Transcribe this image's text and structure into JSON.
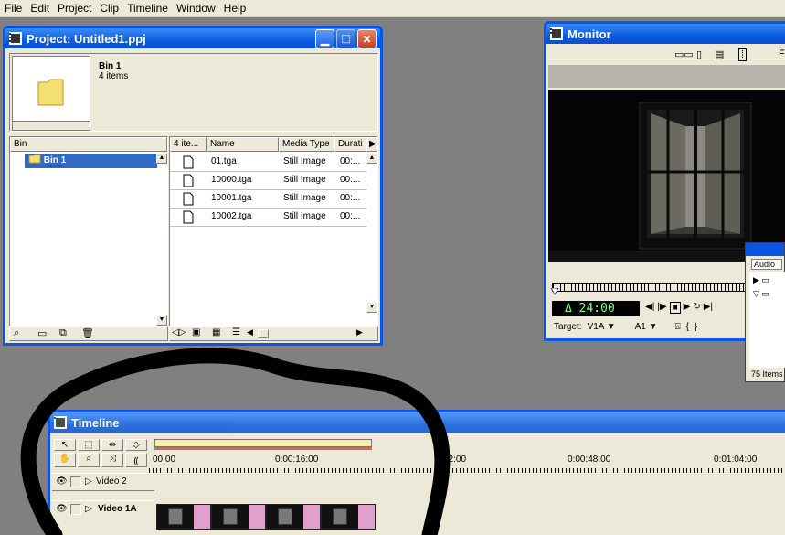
{
  "menubar": {
    "items": [
      "File",
      "Edit",
      "Project",
      "Clip",
      "Timeline",
      "Window",
      "Help"
    ]
  },
  "project": {
    "title": "Project: Untitled1.ppj",
    "bin_name": "Bin 1",
    "bin_count": "4 items",
    "bin_header": "Bin",
    "tree_item": "Bin 1",
    "columns": [
      "4 ite...",
      "Name",
      "Media Type",
      "Durati"
    ],
    "files": [
      {
        "name": "01.tga",
        "type": "Still Image",
        "duration": "00:..."
      },
      {
        "name": "10000.tga",
        "type": "Still Image",
        "duration": "00:..."
      },
      {
        "name": "10001.tga",
        "type": "Still Image",
        "duration": "00:..."
      },
      {
        "name": "10002.tga",
        "type": "Still Image",
        "duration": "00:..."
      }
    ]
  },
  "monitor": {
    "title": "Monitor",
    "timecode": "Δ 24:00",
    "target_label": "Target:",
    "video_target": "V1A",
    "audio_target": "A1",
    "truncated_label": "F"
  },
  "audio_panel": {
    "tab": "Audio",
    "count": "75 Items"
  },
  "timeline": {
    "title": "Timeline",
    "ruler": [
      "00:00",
      "0:00:16:00",
      "32:00",
      "0:00:48:00",
      "0:01:04:00"
    ],
    "tracks": [
      "Video 2",
      "Video 1A"
    ]
  },
  "colors": {
    "title_blue": "#0a54e6",
    "clip_pink": "#e0a0cc",
    "workarea": "#f4f0a0"
  }
}
